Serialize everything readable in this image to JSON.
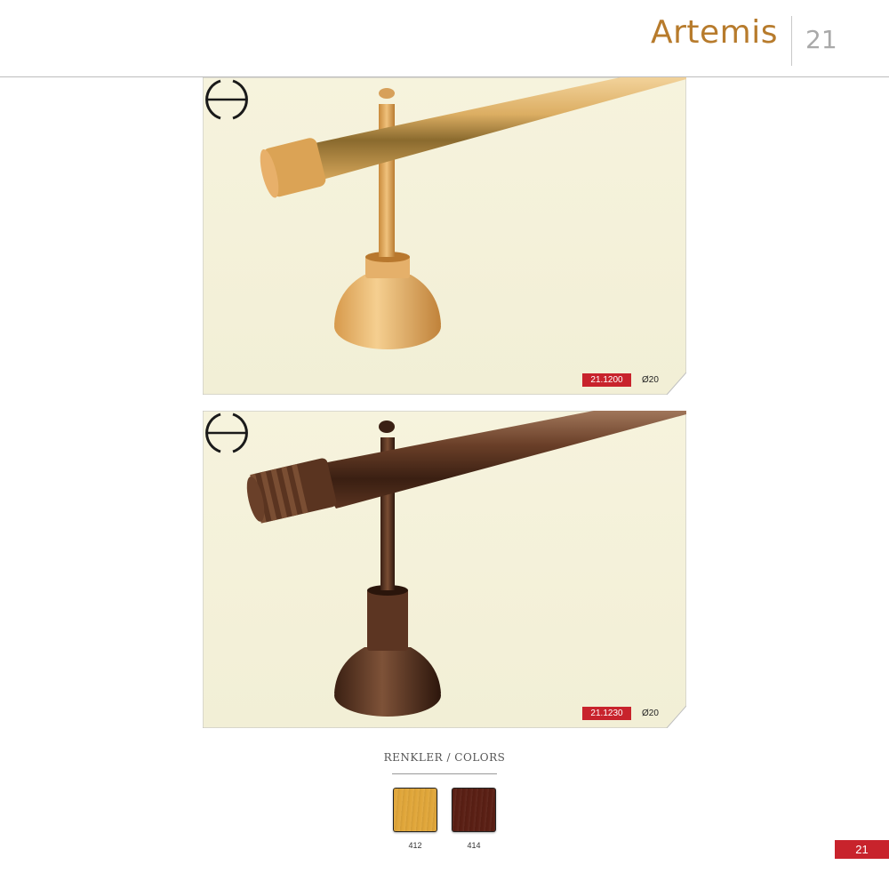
{
  "header": {
    "title": "Artemis",
    "page_number": "21"
  },
  "products": [
    {
      "code": "21.1200",
      "diameter": "Ø20",
      "finish": "light wood",
      "profile_icon": "rod-profile-icon"
    },
    {
      "code": "21.1230",
      "diameter": "Ø20",
      "finish": "dark walnut",
      "profile_icon": "rod-profile-icon"
    }
  ],
  "colors": {
    "title": "RENKLER / COLORS",
    "swatches": [
      {
        "code": "412",
        "hex": "#e0a63a"
      },
      {
        "code": "414",
        "hex": "#5a1f14"
      }
    ]
  },
  "footer": {
    "page_number": "21"
  },
  "palette": {
    "accent": "#c8232c",
    "title_gold": "#b77b2c",
    "panel_bg": "#f7f4e1"
  }
}
